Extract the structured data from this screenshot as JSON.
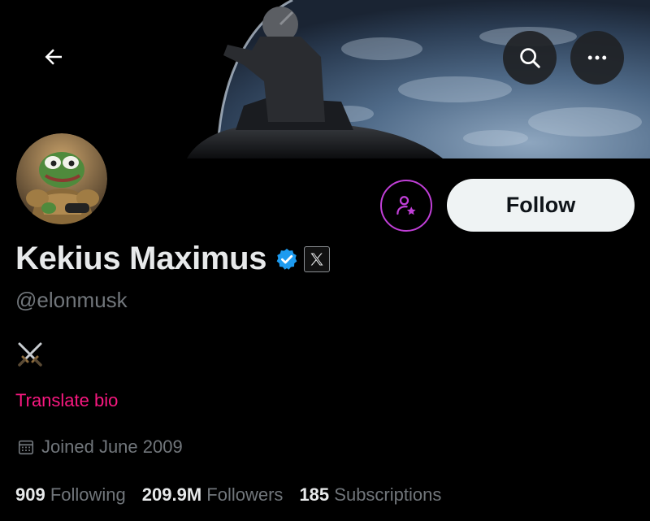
{
  "header": {
    "back_icon": "arrow-left-icon",
    "search_icon": "search-icon",
    "more_icon": "more-horizontal-icon"
  },
  "profile": {
    "display_name": "Kekius Maximus",
    "handle": "@elonmusk",
    "verified_color": "#1d9bf0",
    "affiliate_badge": "x-logo-icon",
    "bio_emoji": "⚔️",
    "translate_label": "Translate bio",
    "joined": "Joined June 2009"
  },
  "actions": {
    "subscribe_icon": "person-star-icon",
    "subscribe_color": "#c13fd8",
    "follow_label": "Follow"
  },
  "stats": [
    {
      "value": "909",
      "label": "Following"
    },
    {
      "value": "209.9M",
      "label": "Followers"
    },
    {
      "value": "185",
      "label": "Subscriptions"
    }
  ],
  "colors": {
    "background": "#000000",
    "primary_text": "#e7e9ea",
    "secondary_text": "#71767b",
    "link_pink": "#f91880"
  }
}
